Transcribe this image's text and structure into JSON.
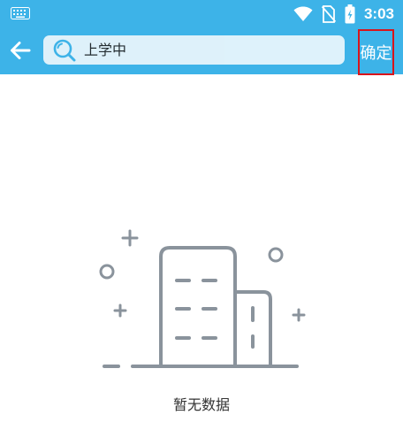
{
  "status_bar": {
    "time": "3:03",
    "icons": [
      "keyboard-icon",
      "wifi-icon",
      "no-sim-icon",
      "battery-charging-icon"
    ]
  },
  "header": {
    "back_icon": "arrow-left-icon",
    "search": {
      "value": "上学中",
      "icon": "search-icon"
    },
    "confirm_label": "确定"
  },
  "empty_state": {
    "illustration": "empty-building-icon",
    "message": "暂无数据"
  },
  "colors": {
    "header": "#3db3e8",
    "search_bg": "#ecf7fc",
    "highlight_border": "#d8141b",
    "illustration_stroke": "#8a939c",
    "text": "#333333"
  }
}
